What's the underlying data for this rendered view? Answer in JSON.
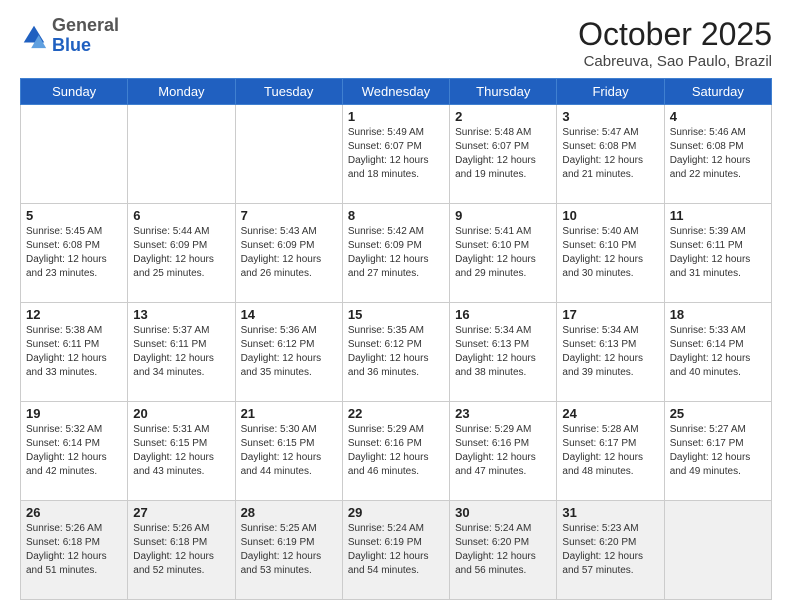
{
  "app": {
    "logo_general": "General",
    "logo_blue": "Blue",
    "month_title": "October 2025",
    "location": "Cabreuva, Sao Paulo, Brazil"
  },
  "calendar": {
    "days_of_week": [
      "Sunday",
      "Monday",
      "Tuesday",
      "Wednesday",
      "Thursday",
      "Friday",
      "Saturday"
    ],
    "weeks": [
      [
        {
          "day": "",
          "info": ""
        },
        {
          "day": "",
          "info": ""
        },
        {
          "day": "",
          "info": ""
        },
        {
          "day": "1",
          "info": "Sunrise: 5:49 AM\nSunset: 6:07 PM\nDaylight: 12 hours\nand 18 minutes."
        },
        {
          "day": "2",
          "info": "Sunrise: 5:48 AM\nSunset: 6:07 PM\nDaylight: 12 hours\nand 19 minutes."
        },
        {
          "day": "3",
          "info": "Sunrise: 5:47 AM\nSunset: 6:08 PM\nDaylight: 12 hours\nand 21 minutes."
        },
        {
          "day": "4",
          "info": "Sunrise: 5:46 AM\nSunset: 6:08 PM\nDaylight: 12 hours\nand 22 minutes."
        }
      ],
      [
        {
          "day": "5",
          "info": "Sunrise: 5:45 AM\nSunset: 6:08 PM\nDaylight: 12 hours\nand 23 minutes."
        },
        {
          "day": "6",
          "info": "Sunrise: 5:44 AM\nSunset: 6:09 PM\nDaylight: 12 hours\nand 25 minutes."
        },
        {
          "day": "7",
          "info": "Sunrise: 5:43 AM\nSunset: 6:09 PM\nDaylight: 12 hours\nand 26 minutes."
        },
        {
          "day": "8",
          "info": "Sunrise: 5:42 AM\nSunset: 6:09 PM\nDaylight: 12 hours\nand 27 minutes."
        },
        {
          "day": "9",
          "info": "Sunrise: 5:41 AM\nSunset: 6:10 PM\nDaylight: 12 hours\nand 29 minutes."
        },
        {
          "day": "10",
          "info": "Sunrise: 5:40 AM\nSunset: 6:10 PM\nDaylight: 12 hours\nand 30 minutes."
        },
        {
          "day": "11",
          "info": "Sunrise: 5:39 AM\nSunset: 6:11 PM\nDaylight: 12 hours\nand 31 minutes."
        }
      ],
      [
        {
          "day": "12",
          "info": "Sunrise: 5:38 AM\nSunset: 6:11 PM\nDaylight: 12 hours\nand 33 minutes."
        },
        {
          "day": "13",
          "info": "Sunrise: 5:37 AM\nSunset: 6:11 PM\nDaylight: 12 hours\nand 34 minutes."
        },
        {
          "day": "14",
          "info": "Sunrise: 5:36 AM\nSunset: 6:12 PM\nDaylight: 12 hours\nand 35 minutes."
        },
        {
          "day": "15",
          "info": "Sunrise: 5:35 AM\nSunset: 6:12 PM\nDaylight: 12 hours\nand 36 minutes."
        },
        {
          "day": "16",
          "info": "Sunrise: 5:34 AM\nSunset: 6:13 PM\nDaylight: 12 hours\nand 38 minutes."
        },
        {
          "day": "17",
          "info": "Sunrise: 5:34 AM\nSunset: 6:13 PM\nDaylight: 12 hours\nand 39 minutes."
        },
        {
          "day": "18",
          "info": "Sunrise: 5:33 AM\nSunset: 6:14 PM\nDaylight: 12 hours\nand 40 minutes."
        }
      ],
      [
        {
          "day": "19",
          "info": "Sunrise: 5:32 AM\nSunset: 6:14 PM\nDaylight: 12 hours\nand 42 minutes."
        },
        {
          "day": "20",
          "info": "Sunrise: 5:31 AM\nSunset: 6:15 PM\nDaylight: 12 hours\nand 43 minutes."
        },
        {
          "day": "21",
          "info": "Sunrise: 5:30 AM\nSunset: 6:15 PM\nDaylight: 12 hours\nand 44 minutes."
        },
        {
          "day": "22",
          "info": "Sunrise: 5:29 AM\nSunset: 6:16 PM\nDaylight: 12 hours\nand 46 minutes."
        },
        {
          "day": "23",
          "info": "Sunrise: 5:29 AM\nSunset: 6:16 PM\nDaylight: 12 hours\nand 47 minutes."
        },
        {
          "day": "24",
          "info": "Sunrise: 5:28 AM\nSunset: 6:17 PM\nDaylight: 12 hours\nand 48 minutes."
        },
        {
          "day": "25",
          "info": "Sunrise: 5:27 AM\nSunset: 6:17 PM\nDaylight: 12 hours\nand 49 minutes."
        }
      ],
      [
        {
          "day": "26",
          "info": "Sunrise: 5:26 AM\nSunset: 6:18 PM\nDaylight: 12 hours\nand 51 minutes."
        },
        {
          "day": "27",
          "info": "Sunrise: 5:26 AM\nSunset: 6:18 PM\nDaylight: 12 hours\nand 52 minutes."
        },
        {
          "day": "28",
          "info": "Sunrise: 5:25 AM\nSunset: 6:19 PM\nDaylight: 12 hours\nand 53 minutes."
        },
        {
          "day": "29",
          "info": "Sunrise: 5:24 AM\nSunset: 6:19 PM\nDaylight: 12 hours\nand 54 minutes."
        },
        {
          "day": "30",
          "info": "Sunrise: 5:24 AM\nSunset: 6:20 PM\nDaylight: 12 hours\nand 56 minutes."
        },
        {
          "day": "31",
          "info": "Sunrise: 5:23 AM\nSunset: 6:20 PM\nDaylight: 12 hours\nand 57 minutes."
        },
        {
          "day": "",
          "info": ""
        }
      ]
    ]
  }
}
